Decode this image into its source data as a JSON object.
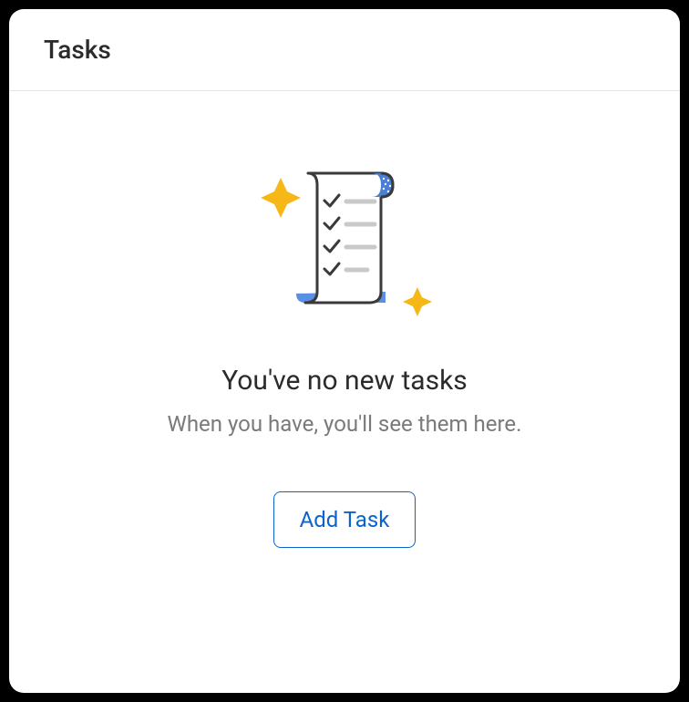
{
  "header": {
    "title": "Tasks"
  },
  "empty_state": {
    "title": "You've no new tasks",
    "subtitle": "When you have, you'll see them here.",
    "button_label": "Add Task",
    "illustration": "checklist-scroll-icon"
  }
}
